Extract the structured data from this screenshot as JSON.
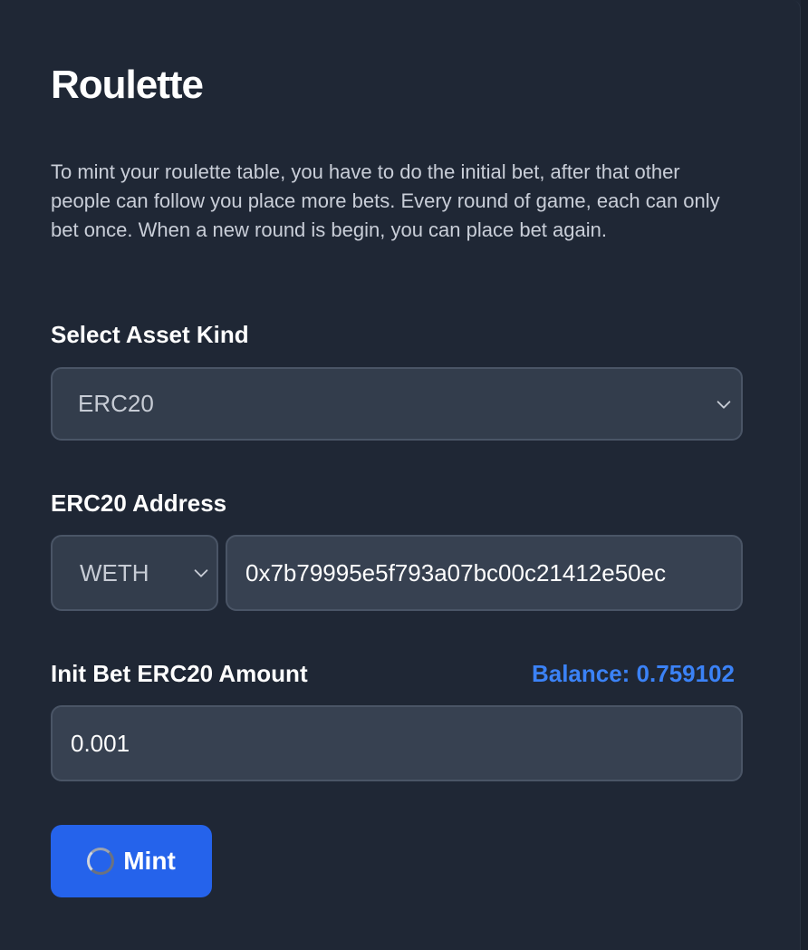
{
  "page": {
    "title": "Roulette",
    "description": "To mint your roulette table, you have to do the initial bet, after that other people can follow you place more bets. Every round of game, each can only bet once. When a new round is begin, you can place bet again."
  },
  "asset_kind": {
    "label": "Select Asset Kind",
    "selected": "ERC20",
    "icon": "chevron-down-icon"
  },
  "erc20_address": {
    "label": "ERC20 Address",
    "token_selected": "WETH",
    "address_value": "0x7b79995e5f793a07bc00c21412e50ec"
  },
  "init_bet": {
    "label": "Init Bet ERC20 Amount",
    "balance": "Balance: 0.759102",
    "amount_value": "0.001"
  },
  "mint_button": {
    "label": "Mint",
    "icon": "spinner-icon"
  },
  "colors": {
    "background": "#1f2735",
    "field": "#333d4c",
    "accent": "#2563eb",
    "balance": "#3b82f6"
  }
}
